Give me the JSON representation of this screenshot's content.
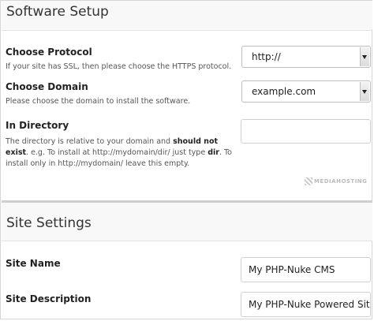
{
  "software_setup": {
    "title": "Software Setup",
    "protocol": {
      "label": "Choose Protocol",
      "hint": "If your site has SSL, then please choose the HTTPS protocol.",
      "selected": "http://"
    },
    "domain": {
      "label": "Choose Domain",
      "hint": "Please choose the domain to install the software.",
      "selected": "example.com"
    },
    "directory": {
      "label": "In Directory",
      "hint_1": "The directory is relative to your domain and ",
      "hint_bold_1": "should not exist",
      "hint_2": ". e.g. To install at http://mydomain/dir/ just type ",
      "hint_bold_2": "dir",
      "hint_3": ". To install only in http://mydomain/ leave this empty.",
      "value": ""
    },
    "watermark": "MEDIAHOSTING"
  },
  "site_settings": {
    "title": "Site Settings",
    "site_name": {
      "label": "Site Name",
      "value": "My PHP-Nuke CMS"
    },
    "site_description": {
      "label": "Site Description",
      "value": "My PHP-Nuke Powered Site"
    }
  }
}
